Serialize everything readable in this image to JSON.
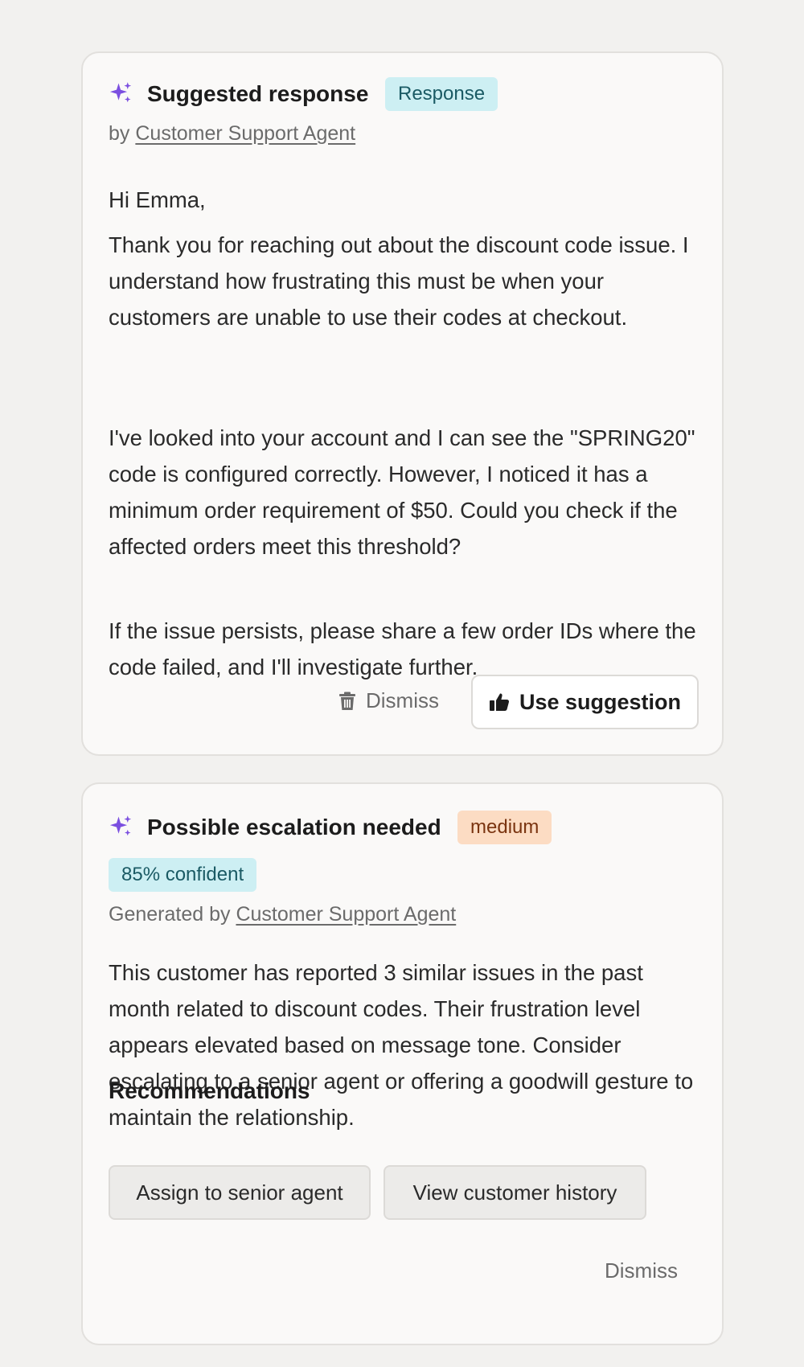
{
  "suggestion_card": {
    "icon": "sparkle-icon",
    "title": "Suggested response",
    "badge": "Response",
    "byline_prefix": "by",
    "author": "Customer Support Agent",
    "greeting": "Hi Emma,",
    "paragraphs": [
      "Thank you for reaching out about the discount code issue. I understand how frustrating this must be when your customers are unable to use their codes at checkout.",
      "I've looked into your account and I can see the \"SPRING20\" code is configured correctly. However, I noticed it has a minimum order requirement of $50. Could you check if the affected orders meet this threshold?",
      "If the issue persists, please share a few order IDs where the code failed, and I'll investigate further."
    ],
    "dismiss_label": "Dismiss",
    "dismiss_icon": "trash-icon",
    "use_label": "Use suggestion",
    "use_icon": "thumbs-up-icon"
  },
  "escalation_card": {
    "icon": "sparkle-icon",
    "title": "Possible escalation needed",
    "severity": "medium",
    "confidence": "85% confident",
    "byline_prefix": "Generated by",
    "author": "Customer Support Agent",
    "description": "This customer has reported 3 similar issues in the past month related to discount codes. Their frustration level appears elevated based on message tone. Consider escalating to a senior agent or offering a goodwill gesture to maintain the relationship.",
    "recommendations_heading": "Recommendations",
    "recommendations": [
      "Assign to senior agent",
      "View customer history"
    ],
    "dismiss_label": "Dismiss"
  },
  "colors": {
    "page_background": "#f2f1ef",
    "card_background": "#faf9f8",
    "sparkle": "#7b4fe0",
    "badge_cyan": "#cdeff3",
    "badge_orange": "#fcdcc3"
  }
}
